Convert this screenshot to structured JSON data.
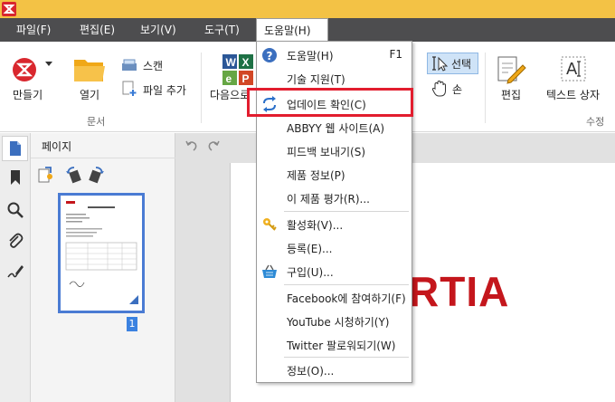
{
  "menubar": {
    "items": [
      "파일(F)",
      "편집(E)",
      "보기(V)",
      "도구(T)",
      "도움말(H)"
    ]
  },
  "ribbon": {
    "create_label": "만들기",
    "open_label": "열기",
    "scan_label": "스캔",
    "add_file_label": "파일 추가",
    "group_document": "문서",
    "next_label": "다음으로",
    "select_label": "선택",
    "hand_label": "손",
    "edit_label": "편집",
    "textbox_label": "텍스트 상자",
    "group_edit": "수정"
  },
  "pages_panel": {
    "title": "페이지",
    "page_number": "1"
  },
  "document": {
    "visible_text": "RTIA"
  },
  "help_menu": {
    "items": [
      {
        "label": "도움말(H)",
        "shortcut": "F1",
        "icon": "help-icon"
      },
      {
        "label": "기술 지원(T)"
      },
      {
        "label": "업데이트 확인(C)",
        "icon": "update-icon",
        "highlighted": true
      },
      {
        "label": "ABBYY 웹 사이트(A)"
      },
      {
        "label": "피드백 보내기(S)"
      },
      {
        "label": "제품 정보(P)"
      },
      {
        "label": "이 제품 평가(R)..."
      },
      {
        "label": "활성화(V)...",
        "icon": "key-icon"
      },
      {
        "label": "등록(E)..."
      },
      {
        "label": "구입(U)...",
        "icon": "basket-icon"
      },
      {
        "label": "Facebook에 참여하기(F)"
      },
      {
        "label": "YouTube 시청하기(Y)"
      },
      {
        "label": "Twitter 팔로워되기(W)"
      },
      {
        "label": "정보(O)..."
      }
    ]
  },
  "colors": {
    "titlebar": "#f3c245",
    "menubar": "#4d4d4f",
    "highlight_border": "#e21d2e",
    "doc_red": "#c4161c"
  }
}
